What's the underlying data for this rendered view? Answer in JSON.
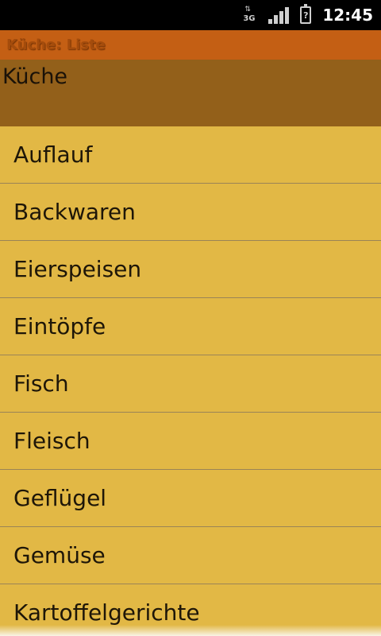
{
  "status_bar": {
    "network_label": "3G",
    "network_icon": "network-3g-icon",
    "signal_icon": "signal-strength-icon",
    "battery_icon": "battery-unknown-icon",
    "battery_symbol": "?",
    "time": "12:45"
  },
  "title_bar": {
    "title": "Küche: Liste"
  },
  "header": {
    "label": "Küche"
  },
  "list": {
    "items": [
      {
        "label": "Auflauf"
      },
      {
        "label": "Backwaren"
      },
      {
        "label": "Eierspeisen"
      },
      {
        "label": "Eintöpfe"
      },
      {
        "label": "Fisch"
      },
      {
        "label": "Fleisch"
      },
      {
        "label": "Geflügel"
      },
      {
        "label": "Gemüse"
      },
      {
        "label": "Kartoffelgerichte"
      }
    ]
  },
  "colors": {
    "title_bar": "#c45f14",
    "header_panel": "#93601a",
    "list_background": "#e2b845",
    "divider": "#9a8457"
  }
}
